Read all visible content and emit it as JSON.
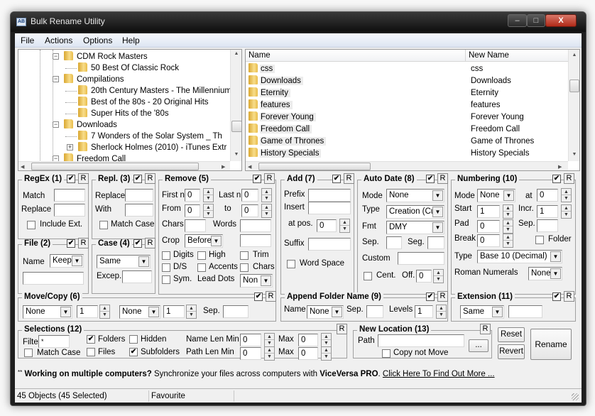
{
  "window": {
    "title": "Bulk Rename Utility",
    "app_icon": "AB",
    "controls": {
      "minimize": "–",
      "maximize": "□",
      "close": "X"
    }
  },
  "menu": [
    "File",
    "Actions",
    "Options",
    "Help"
  ],
  "tree": {
    "items": [
      {
        "label": "CDM Rock Masters",
        "level": 1,
        "toggle": "−"
      },
      {
        "label": "50 Best Of Classic Rock",
        "level": 2,
        "toggle": ""
      },
      {
        "label": "Compilations",
        "level": 1,
        "toggle": "−"
      },
      {
        "label": "20th Century Masters - The Millennium",
        "level": 2,
        "toggle": ""
      },
      {
        "label": "Best of the 80s - 20 Original Hits",
        "level": 2,
        "toggle": ""
      },
      {
        "label": "Super Hits of the '80s",
        "level": 2,
        "toggle": ""
      },
      {
        "label": "Downloads",
        "level": 1,
        "toggle": "−"
      },
      {
        "label": "7 Wonders of the Solar System _ Th",
        "level": 2,
        "toggle": ""
      },
      {
        "label": "Sherlock Holmes (2010) - iTunes Extr",
        "level": 2,
        "toggle": "+"
      },
      {
        "label": "Freedom Call",
        "level": 1,
        "toggle": "−"
      }
    ]
  },
  "filelist": {
    "columns": [
      "Name",
      "New Name"
    ],
    "rows": [
      {
        "name": "css",
        "new_name": "css"
      },
      {
        "name": "Downloads",
        "new_name": "Downloads"
      },
      {
        "name": "Eternity",
        "new_name": "Eternity"
      },
      {
        "name": "features",
        "new_name": "features"
      },
      {
        "name": "Forever Young",
        "new_name": "Forever Young"
      },
      {
        "name": "Freedom Call",
        "new_name": "Freedom Call"
      },
      {
        "name": "Game of Thrones",
        "new_name": "Game of Thrones"
      },
      {
        "name": "History Specials",
        "new_name": "History Specials"
      }
    ]
  },
  "regex": {
    "title": "RegEx (1)",
    "enabled": true,
    "reset": "R",
    "match_label": "Match",
    "match_value": "",
    "replace_label": "Replace",
    "replace_value": "",
    "include_ext_label": "Include Ext.",
    "include_ext": false
  },
  "repl": {
    "title": "Repl. (3)",
    "enabled": true,
    "reset": "R",
    "replace_label": "Replace",
    "replace_value": "",
    "with_label": "With",
    "with_value": "",
    "match_case_label": "Match Case",
    "match_case": false
  },
  "remove": {
    "title": "Remove (5)",
    "enabled": true,
    "reset": "R",
    "first_n_label": "First n",
    "first_n": "0",
    "last_n_label": "Last n",
    "last_n": "0",
    "from_label": "From",
    "from": "0",
    "to_label": "to",
    "to": "0",
    "chars_label": "Chars",
    "chars": "",
    "words_label": "Words",
    "words": "",
    "crop_label": "Crop",
    "crop": "Before",
    "crop_value": "",
    "digits_label": "Digits",
    "high_label": "High",
    "trim_label": "Trim",
    "ds_label": "D/S",
    "accents_label": "Accents",
    "chars2_label": "Chars",
    "sym_label": "Sym.",
    "lead_dots_label": "Lead Dots",
    "lead_dots": "Non"
  },
  "file": {
    "title": "File (2)",
    "enabled": true,
    "reset": "R",
    "name_label": "Name",
    "name_mode": "Keep",
    "name_value": ""
  },
  "case": {
    "title": "Case (4)",
    "enabled": true,
    "reset": "R",
    "mode": "Same",
    "excep_label": "Excep.",
    "excep_value": ""
  },
  "add": {
    "title": "Add (7)",
    "enabled": true,
    "reset": "R",
    "prefix_label": "Prefix",
    "prefix": "",
    "insert_label": "Insert",
    "insert": "",
    "at_pos_label": "at pos.",
    "at_pos": "0",
    "suffix_label": "Suffix",
    "suffix": "",
    "word_space_label": "Word Space",
    "word_space": false
  },
  "autodate": {
    "title": "Auto Date (8)",
    "enabled": true,
    "reset": "R",
    "mode_label": "Mode",
    "mode": "None",
    "type_label": "Type",
    "type": "Creation (Cur",
    "fmt_label": "Fmt",
    "fmt": "DMY",
    "sep_label": "Sep.",
    "sep": "",
    "seg_label": "Seg.",
    "seg": "",
    "custom_label": "Custom",
    "custom": "",
    "cent_label": "Cent.",
    "cent": false,
    "off_label": "Off.",
    "off": "0"
  },
  "numbering": {
    "title": "Numbering (10)",
    "enabled": true,
    "reset": "R",
    "mode_label": "Mode",
    "mode": "None",
    "at_label": "at",
    "at": "0",
    "start_label": "Start",
    "start": "1",
    "incr_label": "Incr.",
    "incr": "1",
    "pad_label": "Pad",
    "pad": "0",
    "sep_label": "Sep.",
    "sep": "",
    "break_label": "Break",
    "break": "0",
    "folder_label": "Folder",
    "folder": false,
    "type_label": "Type",
    "type": "Base 10 (Decimal)",
    "roman_label": "Roman Numerals",
    "roman": "None"
  },
  "movecopy": {
    "title": "Move/Copy (6)",
    "enabled": true,
    "reset": "R",
    "mode1": "None",
    "count1": "1",
    "mode2": "None",
    "count2": "1",
    "sep_label": "Sep.",
    "sep": ""
  },
  "appendfolder": {
    "title": "Append Folder Name (9)",
    "enabled": true,
    "reset": "R",
    "name_label": "Name",
    "name": "None",
    "sep_label": "Sep.",
    "sep": "",
    "levels_label": "Levels",
    "levels": "1"
  },
  "extension": {
    "title": "Extension (11)",
    "enabled": true,
    "reset": "R",
    "mode": "Same",
    "value": ""
  },
  "selections": {
    "title": "Selections (12)",
    "reset": "R",
    "filter_label": "Filter",
    "filter": "*",
    "match_case_label": "Match Case",
    "match_case": false,
    "folders_label": "Folders",
    "folders": true,
    "files_label": "Files",
    "files": false,
    "hidden_label": "Hidden",
    "hidden": false,
    "subfolders_label": "Subfolders",
    "subfolders": true,
    "name_len_min_label": "Name Len Min",
    "name_len_min": "0",
    "name_max_label": "Max",
    "name_len_max": "0",
    "path_len_min_label": "Path Len Min",
    "path_len_min": "0",
    "path_max_label": "Max",
    "path_len_max": "0"
  },
  "newlocation": {
    "title": "New Location (13)",
    "reset": "R",
    "path_label": "Path",
    "path": "",
    "browse": "...",
    "copy_not_move_label": "Copy not Move",
    "copy_not_move": false
  },
  "actions": {
    "reset": "Reset",
    "revert": "Revert",
    "rename": "Rename"
  },
  "promo": {
    "prefix": "**",
    "bold1": "Working on multiple computers?",
    "text": " Synchronize your files across computers with ",
    "bold2": "ViceVersa PRO",
    "dot": ". ",
    "link": "Click Here To Find Out More ..."
  },
  "status": {
    "objects": "45 Objects (45 Selected)",
    "favourite": "Favourite",
    "extra": ""
  }
}
